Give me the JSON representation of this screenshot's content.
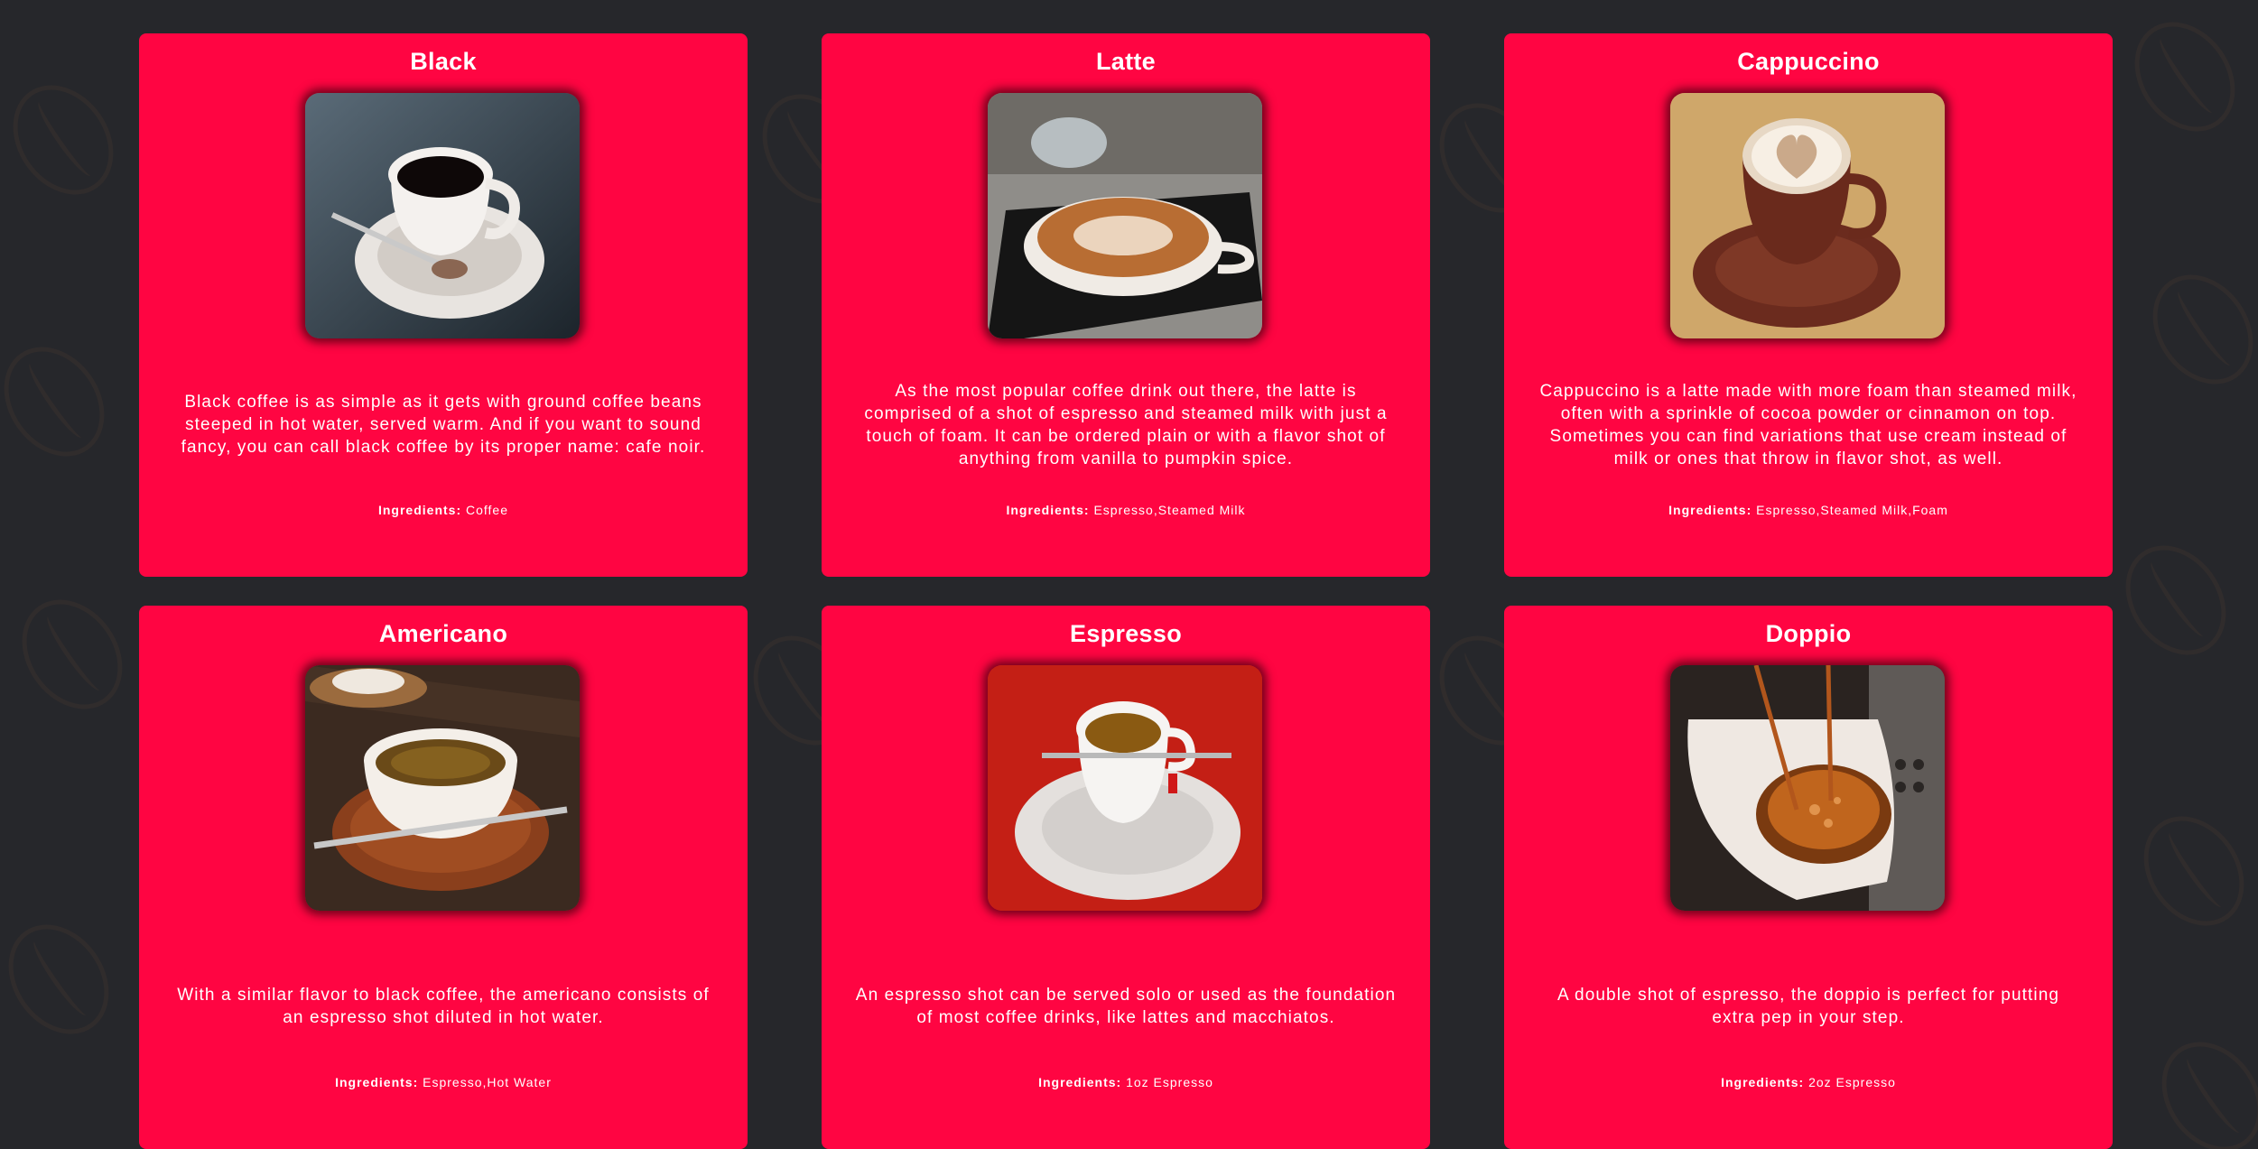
{
  "menu": {
    "cards": [
      {
        "title": "Black",
        "description": "Black coffee is as simple as it gets with ground coffee beans steeped in hot water, served warm. And if you want to sound fancy, you can call black coffee by its proper name: cafe noir.",
        "ingredients_label": "Ingredients:",
        "ingredients": "Coffee"
      },
      {
        "title": "Latte",
        "description": "As the most popular coffee drink out there, the latte is comprised of a shot of espresso and steamed milk with just a touch of foam. It can be ordered plain or with a flavor shot of anything from vanilla to pumpkin spice.",
        "ingredients_label": "Ingredients:",
        "ingredients": "Espresso,Steamed Milk"
      },
      {
        "title": "Cappuccino",
        "description": "Cappuccino is a latte made with more foam than steamed milk, often with a sprinkle of cocoa powder or cinnamon on top. Sometimes you can find variations that use cream instead of milk or ones that throw in flavor shot, as well.",
        "ingredients_label": "Ingredients:",
        "ingredients": "Espresso,Steamed Milk,Foam"
      },
      {
        "title": "Americano",
        "description": "With a similar flavor to black coffee, the americano consists of an espresso shot diluted in hot water.",
        "ingredients_label": "Ingredients:",
        "ingredients": "Espresso,Hot Water"
      },
      {
        "title": "Espresso",
        "description": "An espresso shot can be served solo or used as the foundation of most coffee drinks, like lattes and macchiatos.",
        "ingredients_label": "Ingredients:",
        "ingredients": "1oz Espresso"
      },
      {
        "title": "Doppio",
        "description": "A double shot of espresso, the doppio is perfect for putting extra pep in your step.",
        "ingredients_label": "Ingredients:",
        "ingredients": "2oz Espresso"
      }
    ]
  },
  "colors": {
    "page_background": "#26272b",
    "card_background": "#ff0542",
    "text": "#ffffff"
  }
}
